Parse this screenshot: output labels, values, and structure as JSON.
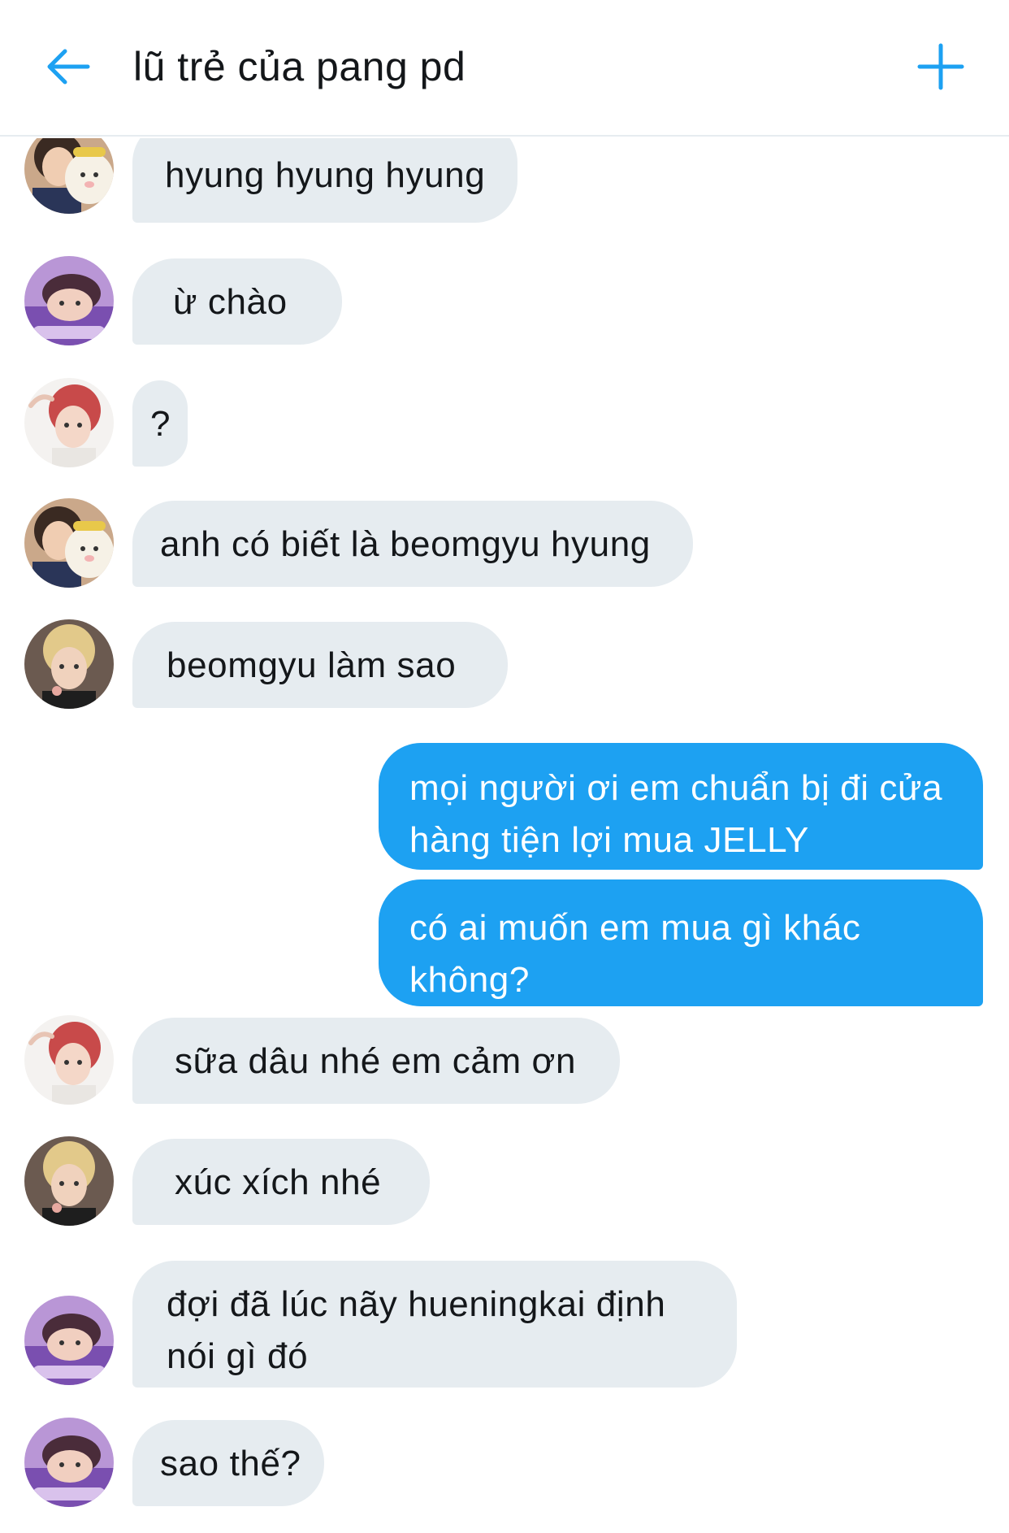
{
  "header": {
    "title": "lũ trẻ của pang pd",
    "back_icon": "arrow-left-icon",
    "add_icon": "plus-icon",
    "accent_color": "#1da1f2"
  },
  "avatars": {
    "a": "avatar-boy-with-plush",
    "b": "avatar-boy-lying-purple",
    "c": "avatar-boy-red-hair",
    "d": "avatar-boy-blonde-hair"
  },
  "messages": [
    {
      "sender": "a",
      "text": "hyung hyung hyung"
    },
    {
      "sender": "b",
      "text": "ừ chào"
    },
    {
      "sender": "c",
      "text": "?"
    },
    {
      "sender": "a",
      "text": "anh có biết là beomgyu hyung"
    },
    {
      "sender": "d",
      "text": "beomgyu làm sao"
    },
    {
      "sender": "me",
      "text": "mọi người ơi em chuẩn bị đi cửa hàng tiện lợi mua JELLY"
    },
    {
      "sender": "me",
      "text": "có ai muốn em mua gì khác không?"
    },
    {
      "sender": "c",
      "text": "sữa dâu nhé em cảm ơn"
    },
    {
      "sender": "d",
      "text": "xúc xích nhé"
    },
    {
      "sender": "b",
      "text": "đợi đã lúc nãy hueningkai định nói gì đó"
    },
    {
      "sender": "b",
      "text": "sao thế?"
    }
  ],
  "colors": {
    "received_bubble": "#e6ecf0",
    "sent_bubble": "#1da1f2",
    "text": "#14171a"
  }
}
